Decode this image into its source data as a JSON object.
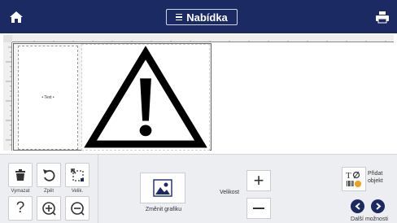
{
  "topbar": {
    "menu_label": "Nabídka",
    "home_icon": "home-icon",
    "print_icon": "printer-icon",
    "background": "#1b2a63"
  },
  "canvas": {
    "text_object": "• Text •",
    "graphic": "warning-triangle-exclamation"
  },
  "toolbar": {
    "delete_label": "Vymazat",
    "undo_label": "Zpět",
    "size_label": "Velik.",
    "change_graphic_label": "Změnit grafiku",
    "resize_label": "Velikost",
    "add_object_label_1": "Přidat",
    "add_object_label_2": "objekt",
    "more_options_label": "Další možnosti"
  },
  "colors": {
    "accent": "#1b2a63",
    "toolbar_bg": "#eceef1"
  }
}
